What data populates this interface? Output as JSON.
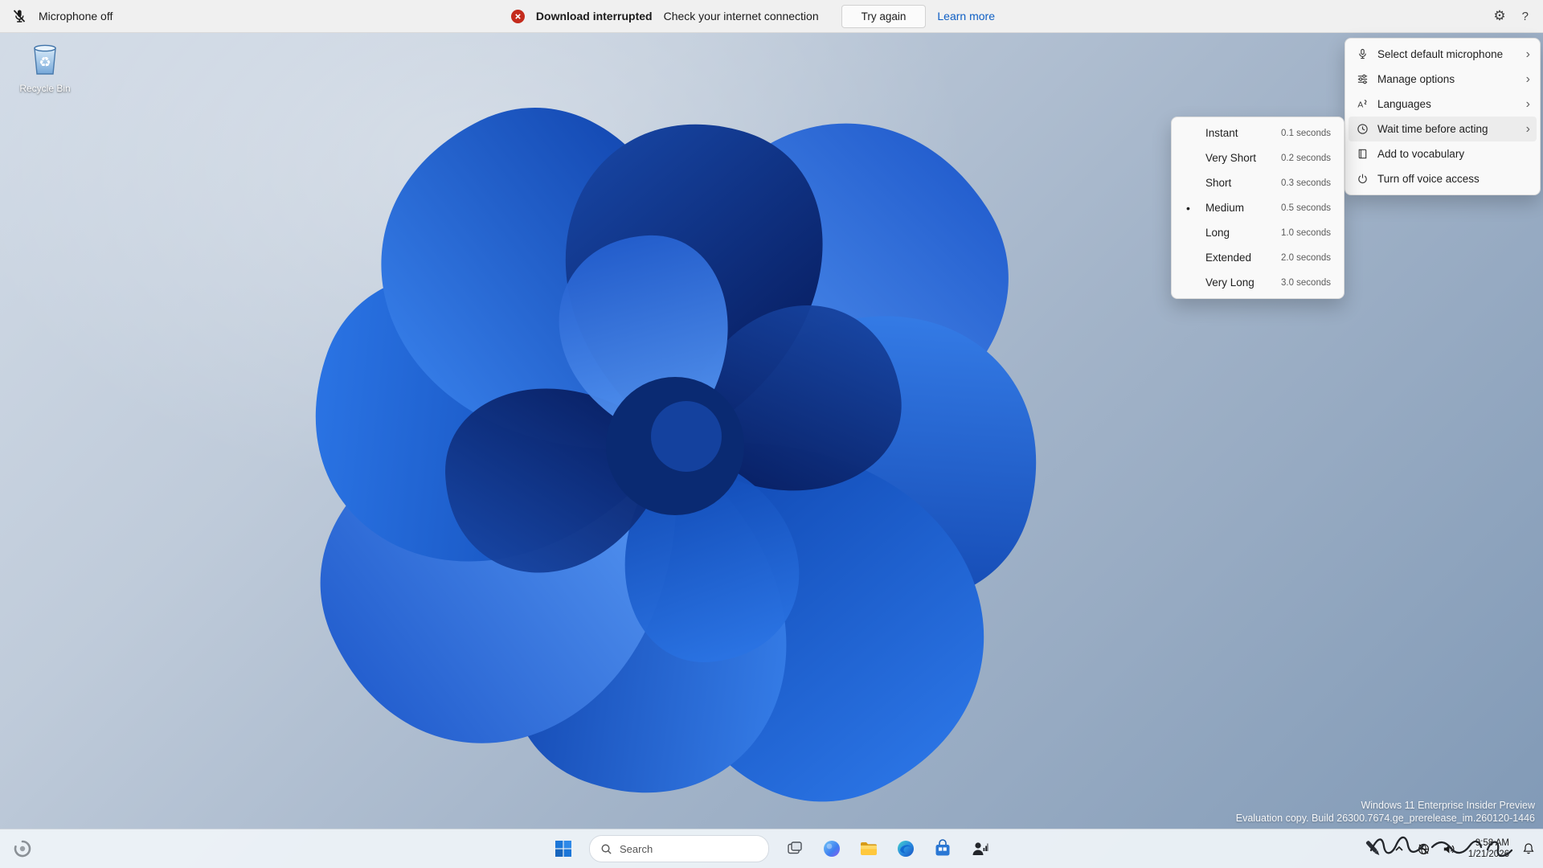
{
  "voice_bar": {
    "mic_status": "Microphone off",
    "notification": {
      "title": "Download interrupted",
      "message": "Check your internet connection",
      "try_again_label": "Try again",
      "learn_more_label": "Learn more"
    }
  },
  "icons": {
    "gear": "⚙",
    "help": "?",
    "chevron_right": "›",
    "selected_bullet": "•"
  },
  "voice_menu": {
    "items": [
      {
        "label": "Select default microphone",
        "icon": "microphone-icon",
        "has_submenu": true
      },
      {
        "label": "Manage options",
        "icon": "sliders-icon",
        "has_submenu": true
      },
      {
        "label": "Languages",
        "icon": "language-icon",
        "has_submenu": true
      },
      {
        "label": "Wait time before acting",
        "icon": "clock-icon",
        "has_submenu": true,
        "highlighted": true
      },
      {
        "label": "Add to vocabulary",
        "icon": "book-icon",
        "has_submenu": false
      },
      {
        "label": "Turn off voice access",
        "icon": "power-icon",
        "has_submenu": false
      }
    ]
  },
  "wait_submenu": {
    "items": [
      {
        "label": "Instant",
        "value": "0.1 seconds",
        "selected": false
      },
      {
        "label": "Very Short",
        "value": "0.2 seconds",
        "selected": false
      },
      {
        "label": "Short",
        "value": "0.3 seconds",
        "selected": false
      },
      {
        "label": "Medium",
        "value": "0.5 seconds",
        "selected": true
      },
      {
        "label": "Long",
        "value": "1.0 seconds",
        "selected": false
      },
      {
        "label": "Extended",
        "value": "2.0 seconds",
        "selected": false
      },
      {
        "label": "Very Long",
        "value": "3.0 seconds",
        "selected": false
      }
    ]
  },
  "desktop": {
    "recycle_bin_label": "Recycle Bin",
    "watermark_line1": "Windows 11 Enterprise Insider Preview",
    "watermark_line2": "Evaluation copy. Build 26300.7674.ge_prerelease_im.260120-1446"
  },
  "taskbar": {
    "search_placeholder": "Search",
    "tray": {
      "time": "9:58 AM",
      "date": "1/21/2026"
    }
  },
  "colors": {
    "accent_blue": "#1b73d3",
    "error_red": "#c42b1c",
    "link_blue": "#0f5fc4",
    "bar_bg": "#f0f0f0",
    "menu_bg": "#f9f9f9"
  }
}
